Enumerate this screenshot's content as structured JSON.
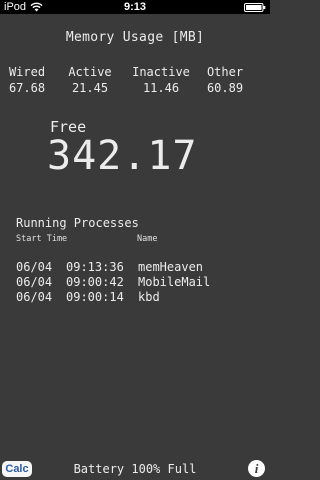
{
  "status_bar": {
    "carrier": "iPod",
    "time": "9:13",
    "wifi_icon": "wifi-icon",
    "battery_icon": "battery-full-icon"
  },
  "memory": {
    "title": "Memory Usage [MB]",
    "stats": [
      {
        "label": "Wired",
        "value": "67.68"
      },
      {
        "label": "Active",
        "value": "21.45"
      },
      {
        "label": "Inactive",
        "value": "11.46"
      },
      {
        "label": "Other",
        "value": "60.89"
      }
    ],
    "free_label": "Free",
    "free_value": "342.17"
  },
  "processes": {
    "title": "Running Processes",
    "headers": {
      "start_time": "Start Time",
      "name": "Name"
    },
    "rows": [
      {
        "date": "06/04",
        "time": "09:13:36",
        "name": "memHeaven"
      },
      {
        "date": "06/04",
        "time": "09:00:42",
        "name": "MobileMail"
      },
      {
        "date": "06/04",
        "time": "09:00:14",
        "name": "kbd"
      }
    ]
  },
  "bottom": {
    "calc_label": "Calc",
    "battery_text": "Battery 100% Full",
    "info_label": "i",
    "info_icon": "info-icon"
  },
  "colors": {
    "background": "#3a3a3a",
    "text": "#ececec",
    "status_bar": "#000000",
    "calc_text": "#2c5ca8"
  }
}
